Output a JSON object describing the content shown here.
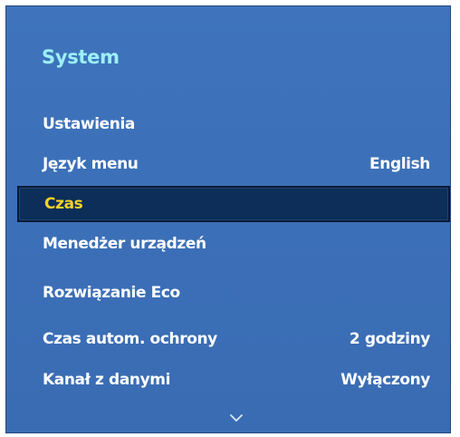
{
  "panel": {
    "title": "System",
    "accent_color": "#9df0f6",
    "background_color": "#3b6fb7",
    "selected_background": "#0c2e58",
    "selected_text_color": "#f7d22a"
  },
  "menu": {
    "items": [
      {
        "label": "Ustawienia",
        "value": ""
      },
      {
        "label": "Język menu",
        "value": "English"
      },
      {
        "label": "Czas",
        "value": "",
        "selected": true
      },
      {
        "label": "Menedżer urządzeń",
        "value": ""
      },
      {
        "label": "Rozwiązanie Eco",
        "value": ""
      },
      {
        "label": "Czas autom. ochrony",
        "value": "2 godziny"
      },
      {
        "label": "Kanał z danymi",
        "value": "Wyłączony"
      }
    ]
  },
  "scroll": {
    "icon": "chevron-down-icon"
  }
}
